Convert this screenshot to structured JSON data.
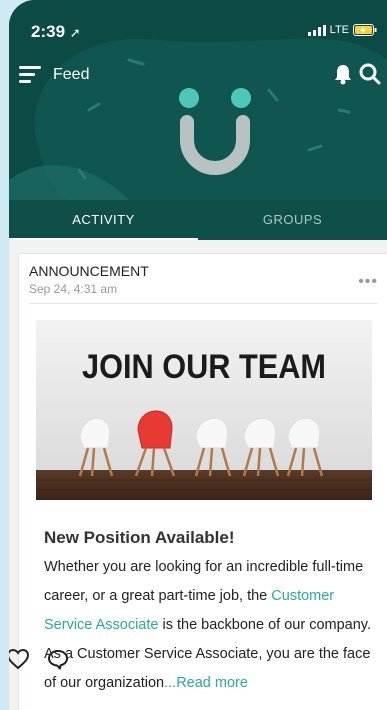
{
  "status": {
    "time": "2:39",
    "network": "LTE"
  },
  "header": {
    "title": "Feed"
  },
  "tabs": [
    {
      "label": "ACTIVITY",
      "active": true
    },
    {
      "label": "GROUPS",
      "active": false
    }
  ],
  "post": {
    "type": "ANNOUNCEMENT",
    "date": "Sep 24, 4:31 am",
    "more": "•••",
    "image_text": "JOIN OUR TEAM",
    "title": "New Position Available!",
    "body_part1": "Whether you are looking for an incredible full-time career, or a great part-time job, the ",
    "link_text": "Customer Service Associate",
    "body_part2": " is the backbone of our company. As a Customer Service Associate, you are the face of our organization",
    "read_more": "...Read more"
  },
  "colors": {
    "header_bg": "#0b4a45",
    "accent": "#2aa9a0",
    "logo_dots": "#4fc7b8"
  }
}
